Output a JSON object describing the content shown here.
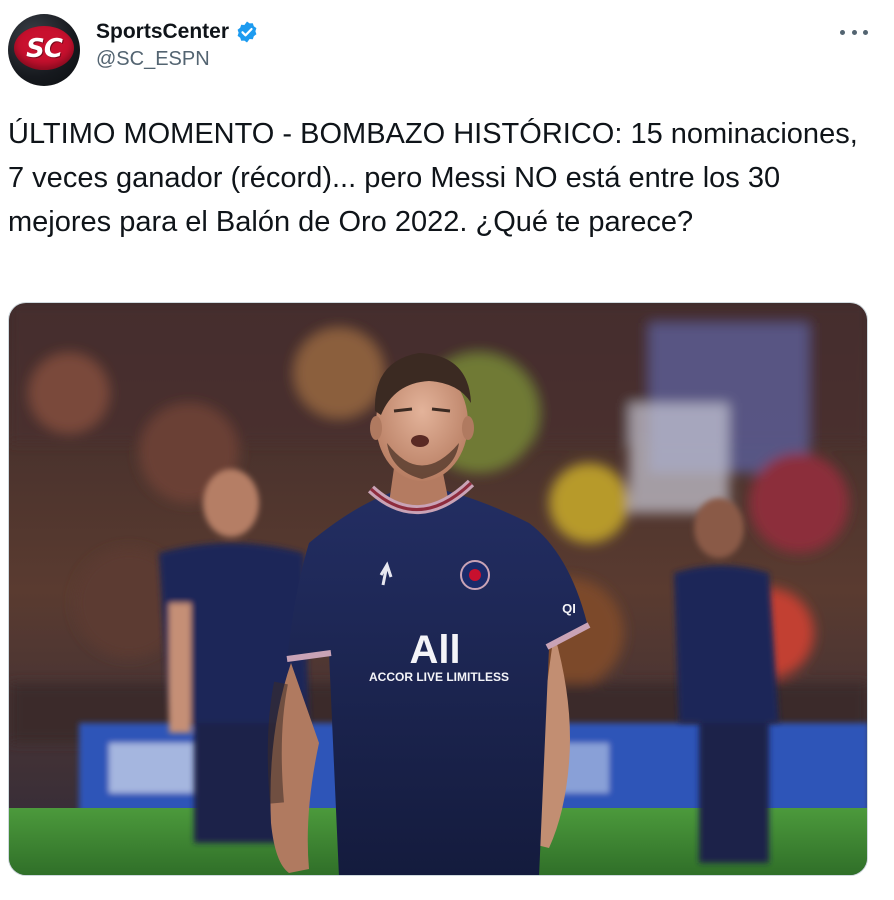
{
  "tweet": {
    "author": {
      "display_name": "SportsCenter",
      "handle": "@SC_ESPN",
      "avatar_text": "SC",
      "verified": true
    },
    "more_icon": "more-horizontal-icon",
    "text": "ÚLTIMO MOMENTO - BOMBAZO HISTÓRICO: 15 nominaciones, 7 veces ganador (récord)... pero Messi NO está entre los 30 mejores para el Balón de Oro 2022. ¿Qué te parece?",
    "media": {
      "jersey_brand": "All",
      "jersey_sponsor": "ACCOR LIVE LIMITLESS",
      "sleeve_text": "QI"
    }
  },
  "colors": {
    "verified_badge": "#1d9bf0",
    "handle": "#536471",
    "jersey": "#1b2550",
    "jersey_trim": "#c9a3b6",
    "pitch": "#3f8a34",
    "sc_red": "#c8102e"
  }
}
